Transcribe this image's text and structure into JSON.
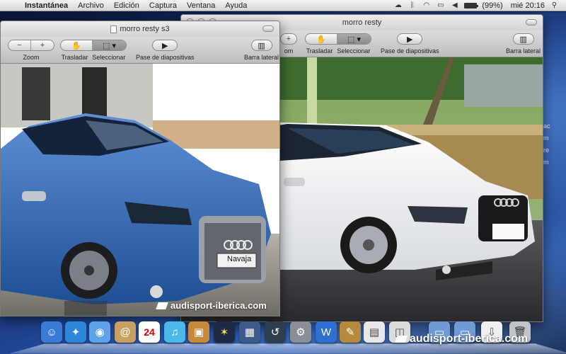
{
  "menubar": {
    "app_name": "Instantánea",
    "menus": [
      "Archivo",
      "Edición",
      "Captura",
      "Ventana",
      "Ayuda"
    ],
    "battery": "(99%)",
    "clock": "mié 20:16"
  },
  "desktop": {
    "side_text": [
      "ac",
      "m",
      "re",
      "m"
    ]
  },
  "window_front": {
    "title": "morro resty s3",
    "toolbar": {
      "zoom_label": "Zoom",
      "zoom_out": "−",
      "zoom_in": "+",
      "move_label": "Trasladar",
      "select_label": "Seleccionar",
      "slideshow_label": "Pase de diapositivas",
      "sidebar_label": "Barra lateral"
    },
    "plate_text": "Navaja",
    "watermark": "audisport-iberica.com"
  },
  "window_back": {
    "title": "morro resty",
    "toolbar": {
      "zoom_label": "om",
      "zoom_in": "+",
      "move_label": "Trasladar",
      "select_label": "Seleccionar",
      "slideshow_label": "Pase de diapositivas",
      "sidebar_label": "Barra lateral"
    },
    "watermark": "audisport-iberica.com"
  },
  "dock": {
    "calendar_day": "24",
    "icons": [
      "finder-icon",
      "safari-icon",
      "ichat-icon",
      "address-book-icon",
      "ical-icon",
      "itunes-icon",
      "iphoto-icon",
      "spaces-icon",
      "dashboard-icon",
      "time-machine-icon",
      "system-preferences-icon",
      "word-icon",
      "gimp-icon",
      "preview-icon",
      "photo-icon",
      "applications-folder-icon",
      "documents-folder-icon",
      "downloads-folder-icon",
      "trash-icon"
    ]
  },
  "colors": {
    "car_front": "#2f67b0",
    "car_back": "#f4f4f4",
    "menubar": "#e6e6e6"
  }
}
